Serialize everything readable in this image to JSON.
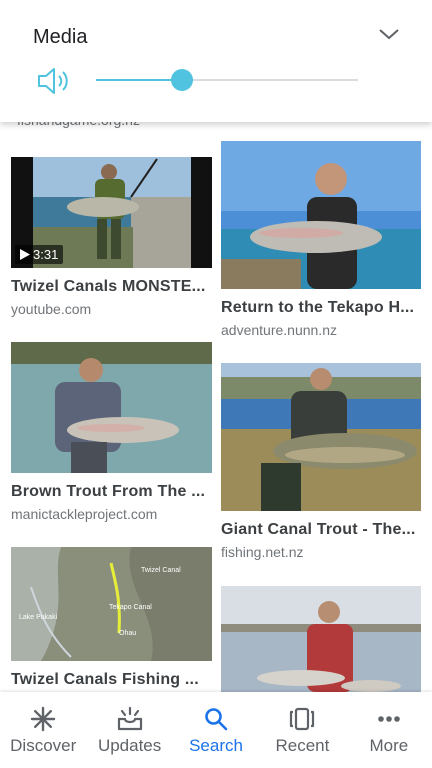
{
  "media": {
    "title": "Media",
    "volume": 0.33
  },
  "results": {
    "partial_source": "fishandgame.org.nz",
    "cards": [
      {
        "title": "Twizel Canals MONSTE...",
        "source": "youtube.com",
        "duration": "3:31"
      },
      {
        "title": "Return to the Tekapo H...",
        "source": "adventure.nunn.nz"
      },
      {
        "title": "Brown Trout From The ...",
        "source": "manictackleproject.com"
      },
      {
        "title": "Giant Canal Trout - The...",
        "source": "fishing.net.nz"
      },
      {
        "title": "Twizel Canals Fishing ...",
        "source": ""
      },
      {
        "title": "",
        "source": ""
      }
    ],
    "map_labels": [
      "Twizel Canal",
      "Tekapo Canal",
      "Ohau",
      "Lake Pukaki"
    ]
  },
  "bottom_nav": {
    "items": [
      {
        "label": "Discover",
        "icon": "asterisk-icon"
      },
      {
        "label": "Updates",
        "icon": "inbox-updates-icon"
      },
      {
        "label": "Search",
        "icon": "search-icon",
        "active": true
      },
      {
        "label": "Recent",
        "icon": "recent-cards-icon"
      },
      {
        "label": "More",
        "icon": "more-dots-icon"
      }
    ],
    "active_color": "#1a73e8",
    "inactive_color": "#5f6368"
  },
  "colors": {
    "slider_accent": "#4fc3e0"
  }
}
